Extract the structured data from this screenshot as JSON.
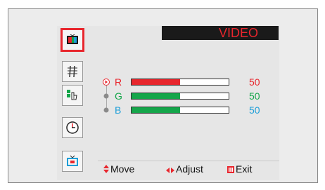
{
  "menu": {
    "title": "VIDEO",
    "sidebar": [
      {
        "icon": "tv-picture-icon",
        "selected": true
      },
      {
        "icon": "music-note-icon",
        "selected": false
      },
      {
        "icon": "channel-hand-icon",
        "selected": false
      },
      {
        "icon": "clock-icon",
        "selected": false
      },
      {
        "icon": "tv-setup-icon",
        "selected": false
      }
    ]
  },
  "settings": [
    {
      "label": "R",
      "value": "50",
      "level": 0.5,
      "color": "#e8262d",
      "active": true
    },
    {
      "label": "G",
      "value": "50",
      "level": 0.5,
      "color": "#14a64a",
      "active": false
    },
    {
      "label": "B",
      "value": "50",
      "level": 0.5,
      "color": "#1e9fd8",
      "active": false
    }
  ],
  "footer": {
    "move": "Move",
    "adjust": "Adjust",
    "exit": "Exit"
  },
  "colors": {
    "accent": "#e8262d",
    "fill_bar": "#14a64a"
  }
}
